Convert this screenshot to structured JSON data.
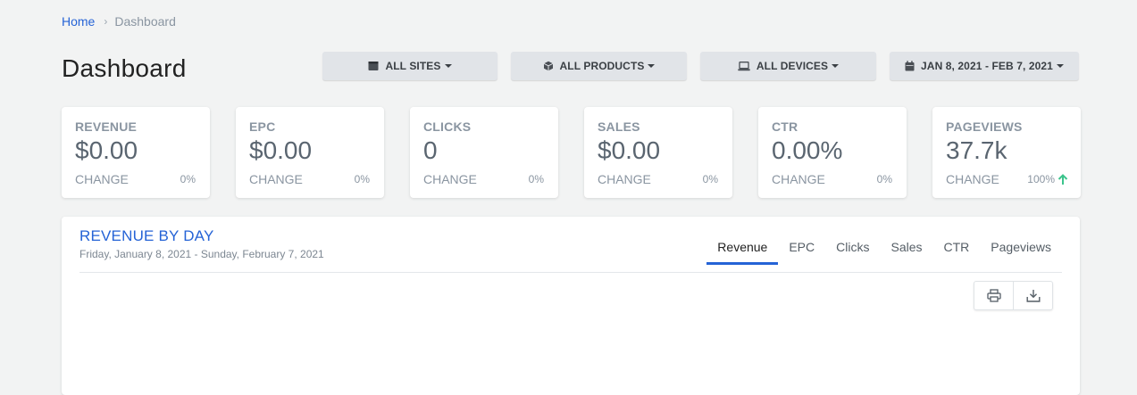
{
  "breadcrumb": {
    "home": "Home",
    "separator": "›",
    "current": "Dashboard"
  },
  "page": {
    "title": "Dashboard"
  },
  "filters": [
    {
      "icon": "calendar-box-icon",
      "label": "ALL SITES"
    },
    {
      "icon": "cube-icon",
      "label": "ALL PRODUCTS"
    },
    {
      "icon": "laptop-icon",
      "label": "ALL DEVICES"
    },
    {
      "icon": "calendar-icon",
      "label": "JAN 8, 2021 - FEB 7, 2021"
    }
  ],
  "stats": [
    {
      "label": "REVENUE",
      "value": "$0.00",
      "change_label": "CHANGE",
      "change": "0%"
    },
    {
      "label": "EPC",
      "value": "$0.00",
      "change_label": "CHANGE",
      "change": "0%"
    },
    {
      "label": "CLICKS",
      "value": "0",
      "change_label": "CHANGE",
      "change": "0%"
    },
    {
      "label": "SALES",
      "value": "$0.00",
      "change_label": "CHANGE",
      "change": "0%"
    },
    {
      "label": "CTR",
      "value": "0.00%",
      "change_label": "CHANGE",
      "change": "0%"
    },
    {
      "label": "PAGEVIEWS",
      "value": "37.7k",
      "change_label": "CHANGE",
      "change": "100%",
      "trend": "up"
    }
  ],
  "panel": {
    "title": "REVENUE BY DAY",
    "subtitle": "Friday, January 8, 2021 - Sunday, February 7, 2021",
    "tabs": [
      "Revenue",
      "EPC",
      "Clicks",
      "Sales",
      "CTR",
      "Pageviews"
    ],
    "active_tab": "Revenue",
    "tools": [
      "print-icon",
      "download-icon"
    ]
  },
  "colors": {
    "accent": "#2563d6",
    "trend_up": "#3cc48c",
    "background": "#f2f3f3"
  }
}
